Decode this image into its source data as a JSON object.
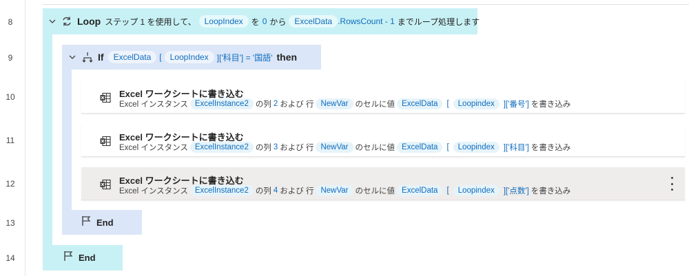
{
  "line_numbers": [
    "8",
    "9",
    "10",
    "11",
    "12",
    "13",
    "14"
  ],
  "loop": {
    "keyword": "Loop",
    "text_1": "ステップ 1 を使用して、",
    "var_index": "LoopIndex",
    "text_2": "を",
    "start": "0",
    "text_3": "から",
    "var_data": "ExcelData",
    "prop": ".RowsCount - 1",
    "text_4": "までループ処理します",
    "end_label": "End"
  },
  "if_block": {
    "keyword": "If",
    "var_data": "ExcelData",
    "bracket_open": "[",
    "var_index": "LoopIndex",
    "expr_tail": "]['科目'] = '国語'",
    "then": "then",
    "end_label": "End"
  },
  "actions": [
    {
      "title": "Excel ワークシートに書き込む",
      "prefix": "Excel インスタンス",
      "instance": "ExcelInstance2",
      "col_text": "の列",
      "col": "2",
      "row_text": "および 行",
      "row_var": "NewVar",
      "value_text": "のセルに値",
      "data_var": "ExcelData",
      "bracket_open": "[",
      "index_var": "Loopindex",
      "key": "]['番号']",
      "suffix": "を書き込み"
    },
    {
      "title": "Excel ワークシートに書き込む",
      "prefix": "Excel インスタンス",
      "instance": "ExcelInstance2",
      "col_text": "の列",
      "col": "3",
      "row_text": "および 行",
      "row_var": "NewVar",
      "value_text": "のセルに値",
      "data_var": "ExcelData",
      "bracket_open": "[",
      "index_var": "Loopindex",
      "key": "]['科目']",
      "suffix": "を書き込み"
    },
    {
      "title": "Excel ワークシートに書き込む",
      "prefix": "Excel インスタンス",
      "instance": "ExcelInstance2",
      "col_text": "の列",
      "col": "4",
      "row_text": "および 行",
      "row_var": "NewVar",
      "value_text": "のセルに値",
      "data_var": "ExcelData",
      "bracket_open": "[",
      "index_var": "Loopindex",
      "key": "]['点数']",
      "suffix": "を書き込み"
    }
  ],
  "colors": {
    "loop_bg": "#c8f1f5",
    "if_bg": "#dbe6f8",
    "variable_text": "#0f6cbd",
    "selected_row_bg": "#efedec"
  },
  "icons": {
    "loop": "loop-icon",
    "if": "branch-icon",
    "end": "flag-icon",
    "excel": "excel-grid-icon",
    "more": "more-vertical-icon",
    "collapse": "chevron-down-icon"
  }
}
